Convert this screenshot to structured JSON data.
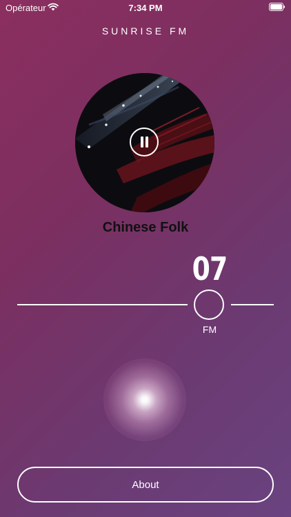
{
  "status_bar": {
    "carrier": "Opérateur",
    "time": "7:34 PM"
  },
  "header": {
    "title": "SUNRISE FM"
  },
  "player": {
    "station_name": "Chinese Folk",
    "frequency": "07",
    "band": "FM",
    "state": "playing"
  },
  "tuner": {
    "position_fraction": 0.74
  },
  "actions": {
    "about_label": "About"
  },
  "colors": {
    "background_start": "#8b2f5f",
    "background_end": "#6a4380",
    "foreground": "#ffffff",
    "station_text": "#111111"
  },
  "icons": {
    "wifi": "wifi-icon",
    "battery": "battery-icon",
    "pause": "pause-icon"
  }
}
